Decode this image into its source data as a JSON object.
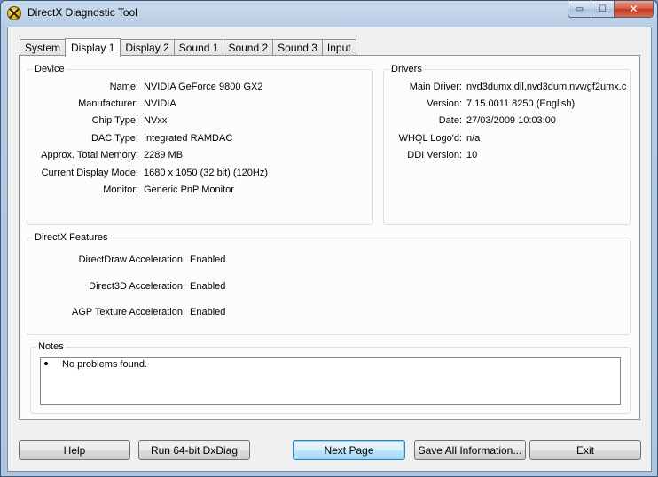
{
  "window": {
    "title": "DirectX Diagnostic Tool"
  },
  "caption": {
    "minimize": "▭",
    "maximize": "☐",
    "close": "✕"
  },
  "tabs": [
    {
      "label": "System"
    },
    {
      "label": "Display 1"
    },
    {
      "label": "Display 2"
    },
    {
      "label": "Sound 1"
    },
    {
      "label": "Sound 2"
    },
    {
      "label": "Sound 3"
    },
    {
      "label": "Input"
    }
  ],
  "active_tab": "Display 1",
  "device": {
    "title": "Device",
    "rows": [
      {
        "label": "Name:",
        "value": "NVIDIA GeForce 9800 GX2"
      },
      {
        "label": "Manufacturer:",
        "value": "NVIDIA"
      },
      {
        "label": "Chip Type:",
        "value": "NVxx"
      },
      {
        "label": "DAC Type:",
        "value": "Integrated RAMDAC"
      },
      {
        "label": "Approx. Total Memory:",
        "value": "2289 MB"
      },
      {
        "label": "Current Display Mode:",
        "value": "1680 x 1050 (32 bit) (120Hz)"
      },
      {
        "label": "Monitor:",
        "value": "Generic PnP Monitor"
      }
    ]
  },
  "drivers": {
    "title": "Drivers",
    "rows": [
      {
        "label": "Main Driver:",
        "value": "nvd3dumx.dll,nvd3dum,nvwgf2umx.c"
      },
      {
        "label": "Version:",
        "value": "7.15.0011.8250 (English)"
      },
      {
        "label": "Date:",
        "value": "27/03/2009 10:03:00"
      },
      {
        "label": "WHQL Logo'd:",
        "value": "n/a"
      },
      {
        "label": "DDI Version:",
        "value": "10"
      }
    ]
  },
  "features": {
    "title": "DirectX Features",
    "rows": [
      {
        "label": "DirectDraw Acceleration:",
        "value": "Enabled"
      },
      {
        "label": "Direct3D Acceleration:",
        "value": "Enabled"
      },
      {
        "label": "AGP Texture Acceleration:",
        "value": "Enabled"
      }
    ]
  },
  "notes": {
    "title": "Notes",
    "items": [
      "No problems found."
    ]
  },
  "buttons": {
    "help": "Help",
    "run64": "Run 64-bit DxDiag",
    "next": "Next Page",
    "save": "Save All Information...",
    "exit": "Exit"
  }
}
